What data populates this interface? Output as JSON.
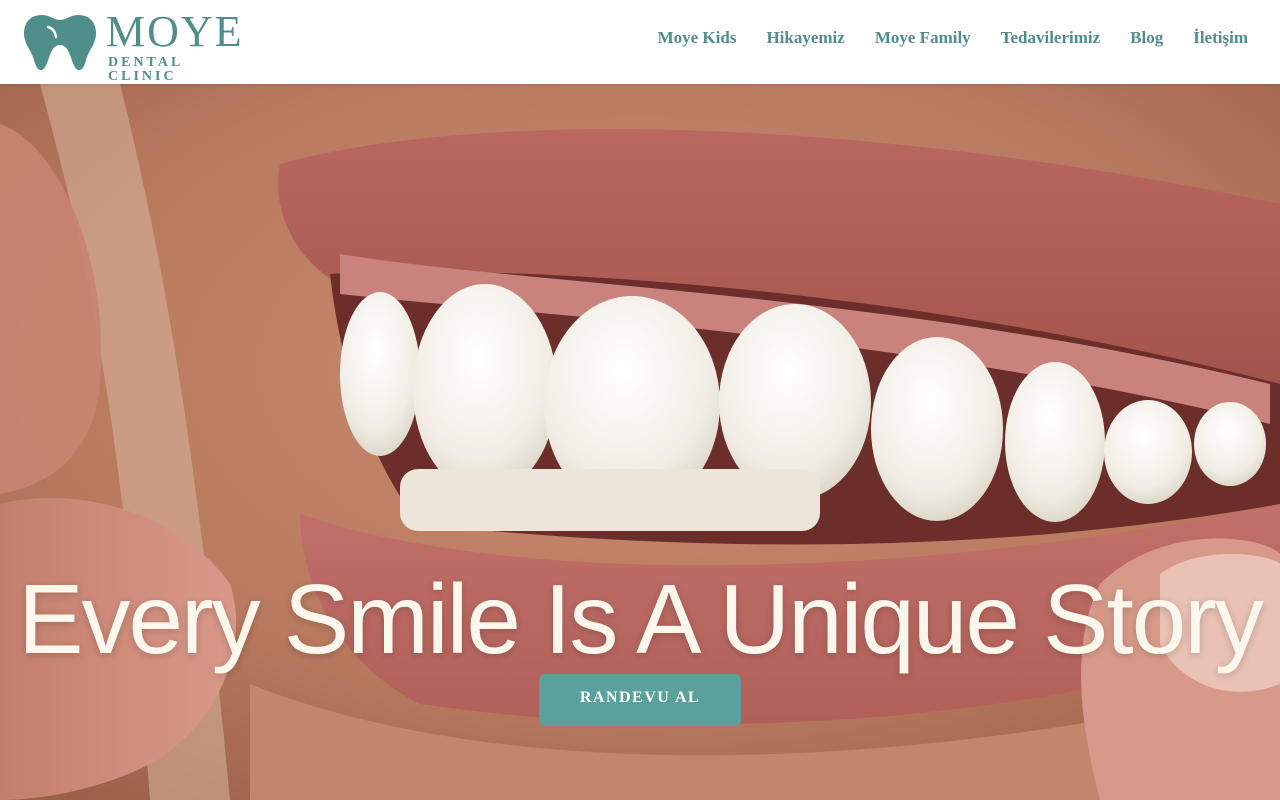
{
  "colors": {
    "brand": "#4f8e8b",
    "cta": "#5aa09b",
    "headline": "#fbf7ec"
  },
  "header": {
    "logo": {
      "icon": "tooth-icon",
      "title": "MOYE",
      "subtitle": "DENTAL CLINIC"
    },
    "nav": [
      {
        "label": "Moye Kids"
      },
      {
        "label": "Hikayemiz"
      },
      {
        "label": "Moye Family"
      },
      {
        "label": "Tedavilerimiz"
      },
      {
        "label": "Blog"
      },
      {
        "label": "İletişim"
      }
    ]
  },
  "hero": {
    "headline": "Every Smile Is A Unique Story",
    "cta_label": "RANDEVU AL"
  }
}
